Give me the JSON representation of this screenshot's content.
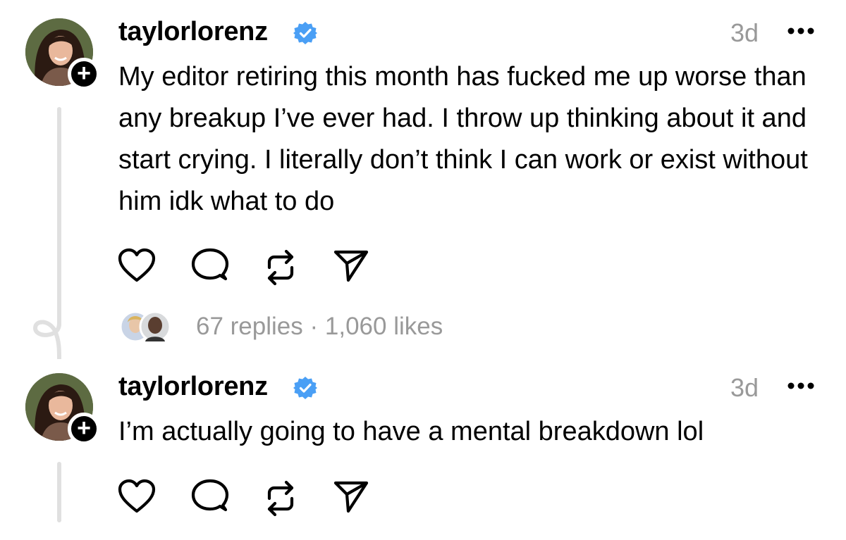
{
  "posts": [
    {
      "username": "taylorlorenz",
      "time": "3d",
      "text": "My editor retiring this month has fucked me up worse than any breakup I’ve ever had. I throw up thinking about it and start crying. I literally don’t think I can work or exist without him idk what to do",
      "replies": "67 replies",
      "separator": "·",
      "likes": "1,060 likes"
    },
    {
      "username": "taylorlorenz",
      "time": "3d",
      "text": "I’m actually going to have a mental breakdown lol"
    }
  ],
  "icons": {
    "verified": "verified-badge-icon",
    "more": "more-horizontal-icon",
    "like": "heart-icon",
    "reply": "comment-icon",
    "repost": "repost-icon",
    "share": "send-icon",
    "follow": "plus-icon"
  },
  "colors": {
    "verified": "#4a9ff5",
    "muted": "#999999",
    "thread_line": "#e0e0e0"
  }
}
